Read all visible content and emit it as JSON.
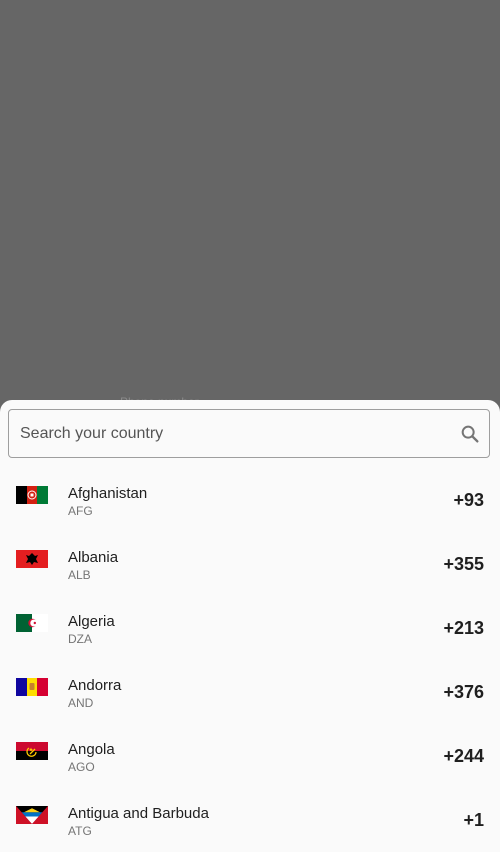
{
  "background": {
    "hint_label": "Phone number"
  },
  "search": {
    "placeholder": "Search your country",
    "icon": "search-icon"
  },
  "colors": {
    "sheet_bg": "#fafafa",
    "scrim": "#666666",
    "text_primary": "#1f1f1f",
    "text_secondary": "#757575"
  },
  "countries": [
    {
      "name": "Afghanistan",
      "code": "AFG",
      "dial": "+93",
      "flag": "afghanistan-flag-icon"
    },
    {
      "name": "Albania",
      "code": "ALB",
      "dial": "+355",
      "flag": "albania-flag-icon"
    },
    {
      "name": "Algeria",
      "code": "DZA",
      "dial": "+213",
      "flag": "algeria-flag-icon"
    },
    {
      "name": "Andorra",
      "code": "AND",
      "dial": "+376",
      "flag": "andorra-flag-icon"
    },
    {
      "name": "Angola",
      "code": "AGO",
      "dial": "+244",
      "flag": "angola-flag-icon"
    },
    {
      "name": "Antigua and Barbuda",
      "code": "ATG",
      "dial": "+1",
      "flag": "antigua-barbuda-flag-icon"
    }
  ]
}
